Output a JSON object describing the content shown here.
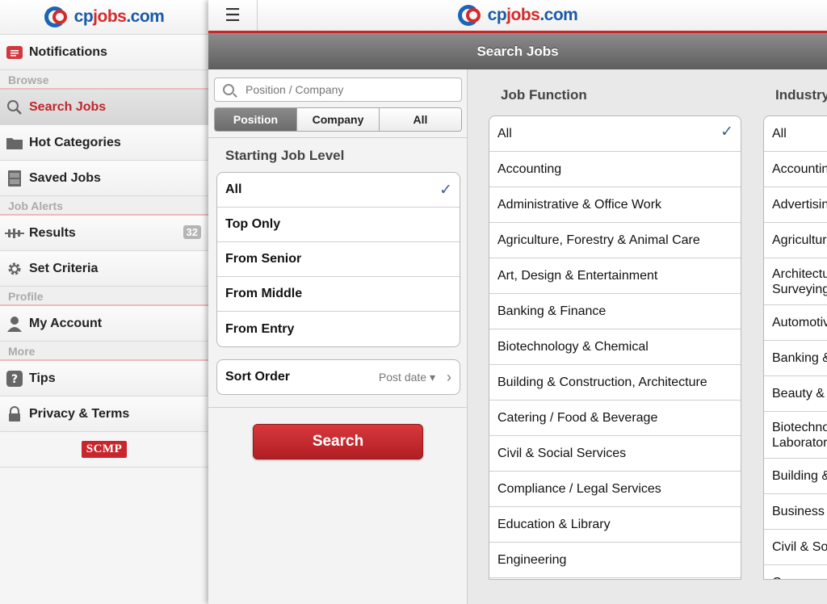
{
  "sidebar": {
    "logo": {
      "cp": "cp",
      "jobs": "jobs",
      "com": ".com"
    },
    "notifications": "Notifications",
    "section_browse": "Browse",
    "search_jobs": "Search Jobs",
    "hot_categories": "Hot Categories",
    "saved_jobs": "Saved Jobs",
    "section_alerts": "Job Alerts",
    "results": "Results",
    "results_count": "32",
    "set_criteria": "Set Criteria",
    "section_profile": "Profile",
    "my_account": "My Account",
    "section_more": "More",
    "tips": "Tips",
    "privacy": "Privacy & Terms",
    "scmp": "SCMP"
  },
  "header": {
    "menu_glyph": "☰",
    "logo": {
      "cp": "cp",
      "jobs": "jobs",
      "com": ".com"
    },
    "title": "Search Jobs"
  },
  "search": {
    "placeholder": "Position / Company",
    "segments": [
      "Position",
      "Company",
      "All"
    ],
    "selected_segment": "Position"
  },
  "job_level": {
    "title": "Starting Job Level",
    "items": [
      "All",
      "Top Only",
      "From Senior",
      "From Middle",
      "From Entry"
    ],
    "selected": "All"
  },
  "sort": {
    "label": "Sort Order",
    "value": "Post date ▾"
  },
  "search_button": "Search",
  "job_function": {
    "title": "Job Function",
    "items": [
      "All",
      "Accounting",
      "Administrative & Office Work",
      "Agriculture, Forestry & Animal Care",
      "Art, Design & Entertainment",
      "Banking & Finance",
      "Biotechnology & Chemical",
      "Building & Construction, Architecture",
      "Catering / Food & Beverage",
      "Civil & Social Services",
      "Compliance / Legal Services",
      "Education & Library",
      "Engineering"
    ],
    "selected": "All"
  },
  "industry": {
    "title": "Industry",
    "items": [
      "All",
      "Accounting",
      "Advertising",
      "Agriculture",
      "Architecture Surveying",
      "Automotive",
      "Banking &",
      "Beauty &",
      "Biotechnology Laboratory",
      "Building &",
      "Business",
      "Civil & Social",
      "C"
    ]
  },
  "colors": {
    "brand_red": "#c8262c",
    "brand_blue": "#1a5aa8",
    "check_blue": "#3d5f8f"
  }
}
